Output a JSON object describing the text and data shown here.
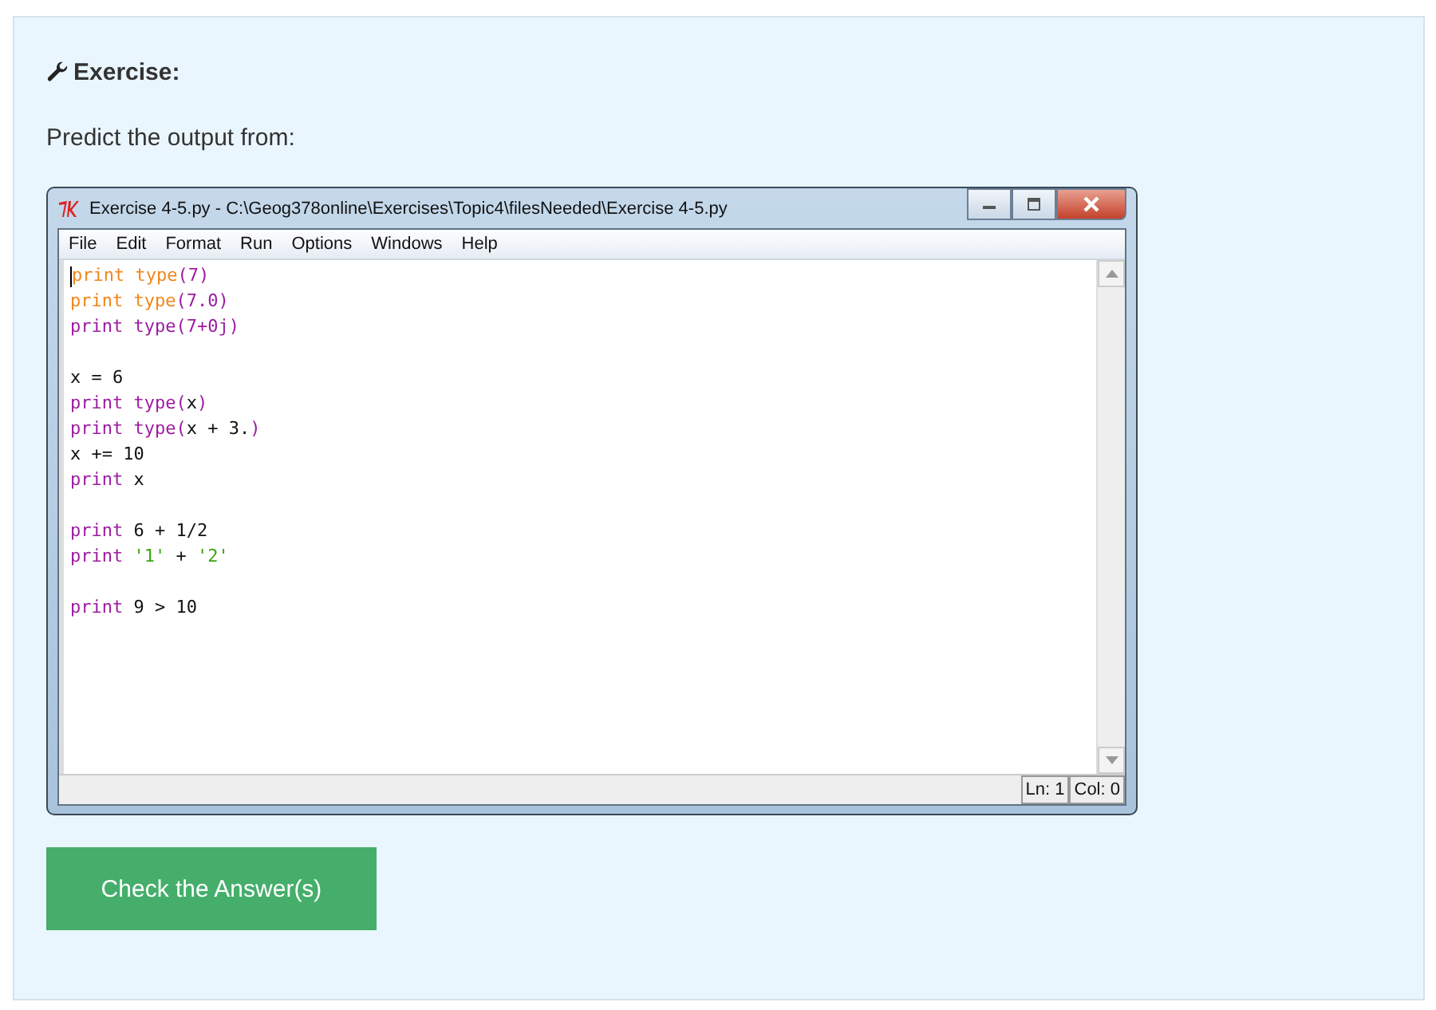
{
  "heading": "Exercise:",
  "prompt": "Predict the output from:",
  "window": {
    "title": "Exercise 4-5.py - C:\\Geog378online\\Exercises\\Topic4\\filesNeeded\\Exercise 4-5.py",
    "menu": [
      "File",
      "Edit",
      "Format",
      "Run",
      "Options",
      "Windows",
      "Help"
    ],
    "code": [
      {
        "kind": "code",
        "tokens": [
          {
            "kind": "hl",
            "text": "print type"
          },
          {
            "kind": "kw",
            "text": "(7)"
          }
        ]
      },
      {
        "kind": "code",
        "tokens": [
          {
            "kind": "hl",
            "text": "print type"
          },
          {
            "kind": "kw",
            "text": "(7.0)"
          }
        ]
      },
      {
        "kind": "code",
        "tokens": [
          {
            "kind": "kw",
            "text": "print type(7+0j)"
          }
        ]
      },
      {
        "kind": "blank"
      },
      {
        "kind": "code",
        "tokens": [
          {
            "kind": "plain",
            "text": "x = 6"
          }
        ]
      },
      {
        "kind": "code",
        "tokens": [
          {
            "kind": "kw",
            "text": "print type("
          },
          {
            "kind": "plain",
            "text": "x"
          },
          {
            "kind": "kw",
            "text": ")"
          }
        ]
      },
      {
        "kind": "code",
        "tokens": [
          {
            "kind": "kw",
            "text": "print type("
          },
          {
            "kind": "plain",
            "text": "x + 3."
          },
          {
            "kind": "kw",
            "text": ")"
          }
        ]
      },
      {
        "kind": "code",
        "tokens": [
          {
            "kind": "plain",
            "text": "x += 10"
          }
        ]
      },
      {
        "kind": "code",
        "tokens": [
          {
            "kind": "kw",
            "text": "print "
          },
          {
            "kind": "plain",
            "text": "x"
          }
        ]
      },
      {
        "kind": "blank"
      },
      {
        "kind": "code",
        "tokens": [
          {
            "kind": "kw",
            "text": "print "
          },
          {
            "kind": "plain",
            "text": "6 + 1/2"
          }
        ]
      },
      {
        "kind": "code",
        "tokens": [
          {
            "kind": "kw",
            "text": "print "
          },
          {
            "kind": "str",
            "text": "'1'"
          },
          {
            "kind": "plain",
            "text": " + "
          },
          {
            "kind": "str",
            "text": "'2'"
          }
        ]
      },
      {
        "kind": "blank"
      },
      {
        "kind": "code",
        "tokens": [
          {
            "kind": "kw",
            "text": "print "
          },
          {
            "kind": "plain",
            "text": "9 > 10"
          }
        ]
      }
    ],
    "status": [
      "Ln: 1",
      "Col: 0"
    ]
  },
  "button": "Check the Answer(s)"
}
